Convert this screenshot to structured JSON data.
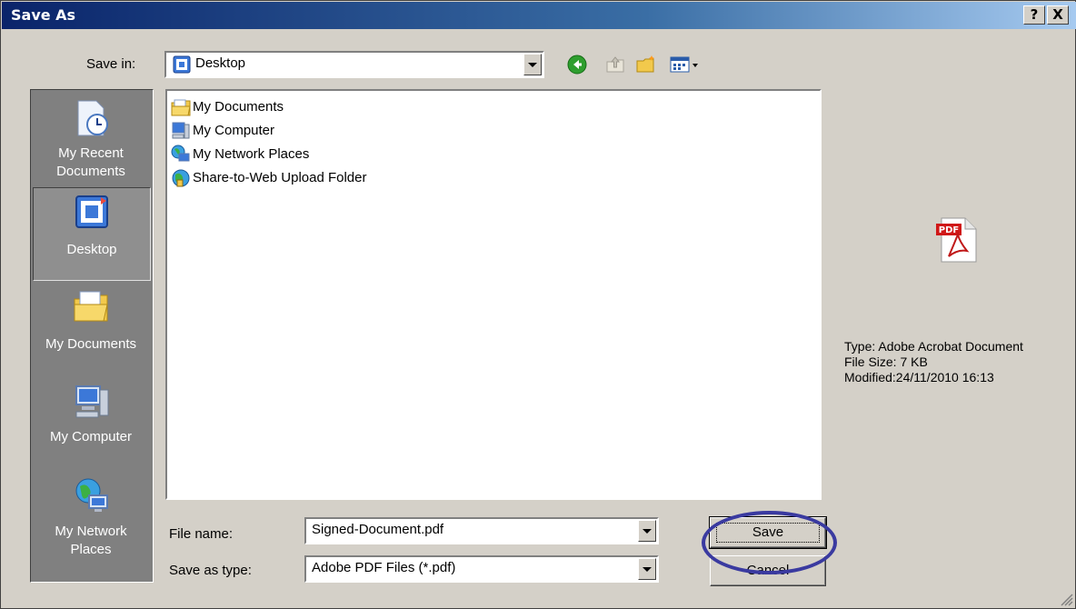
{
  "titlebar": {
    "title": "Save As",
    "help_label": "?",
    "close_label": "X"
  },
  "save_in": {
    "label": "Save in:",
    "value": "Desktop"
  },
  "toolbar": {
    "icons": [
      "back-icon",
      "up-folder-icon",
      "new-folder-icon",
      "view-menu-icon"
    ]
  },
  "places": [
    {
      "label_line1": "My Recent",
      "label_line2": "Documents",
      "icon": "recent-documents-icon"
    },
    {
      "label_line1": "Desktop",
      "label_line2": "",
      "icon": "desktop-icon"
    },
    {
      "label_line1": "My Documents",
      "label_line2": "",
      "icon": "my-documents-icon"
    },
    {
      "label_line1": "My Computer",
      "label_line2": "",
      "icon": "my-computer-icon"
    },
    {
      "label_line1": "My Network",
      "label_line2": "Places",
      "icon": "network-places-icon"
    }
  ],
  "files": [
    {
      "name": "My Documents",
      "icon": "folder-documents-icon"
    },
    {
      "name": "My Computer",
      "icon": "computer-icon"
    },
    {
      "name": "My Network Places",
      "icon": "network-icon"
    },
    {
      "name": "Share-to-Web Upload Folder",
      "icon": "web-folder-icon"
    }
  ],
  "preview": {
    "type_line": "Type: Adobe Acrobat Document",
    "size_line": "File Size: 7 KB",
    "modified_line": "Modified:24/11/2010 16:13",
    "icon_text": "PDF"
  },
  "file_name": {
    "label": "File name:",
    "value": "Signed-Document.pdf"
  },
  "save_as_type": {
    "label": "Save as type:",
    "value": "Adobe PDF Files (*.pdf)"
  },
  "buttons": {
    "save": "Save",
    "cancel": "Cancel"
  },
  "colors": {
    "title_gradient_start": "#0a246a",
    "dialog_face": "#d4d0c8",
    "places_bar": "#808080",
    "highlight_ring": "#3a3aa0"
  }
}
